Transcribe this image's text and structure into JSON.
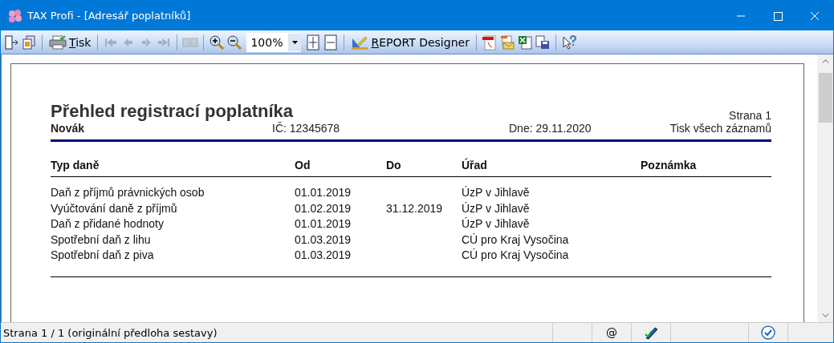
{
  "window": {
    "title": "TAX Profi - [Adresář poplatníků]"
  },
  "toolbar": [
    {
      "kind": "icon",
      "disabled": false
    },
    {
      "kind": "icon",
      "disabled": false
    },
    {
      "kind": "separator"
    },
    {
      "kind": "button",
      "label": "Tisk",
      "disabled": false
    },
    {
      "kind": "separator"
    },
    {
      "kind": "icon",
      "disabled": true
    },
    {
      "kind": "icon",
      "disabled": true
    },
    {
      "kind": "icon",
      "disabled": true
    },
    {
      "kind": "icon",
      "disabled": true
    },
    {
      "kind": "separator"
    },
    {
      "kind": "icon",
      "disabled": true
    },
    {
      "kind": "separator"
    },
    {
      "kind": "icon",
      "disabled": false
    },
    {
      "kind": "icon",
      "disabled": false
    },
    {
      "kind": "combo",
      "value": "100%"
    },
    {
      "kind": "icon",
      "disabled": false
    },
    {
      "kind": "icon",
      "disabled": false
    },
    {
      "kind": "separator"
    },
    {
      "kind": "button",
      "label": "REPORT Designer",
      "disabled": false
    },
    {
      "kind": "separator"
    },
    {
      "kind": "icon",
      "disabled": false
    },
    {
      "kind": "icon",
      "disabled": false
    },
    {
      "kind": "icon",
      "disabled": false
    },
    {
      "kind": "icon",
      "disabled": false
    },
    {
      "kind": "separator"
    },
    {
      "kind": "icon",
      "disabled": false
    }
  ],
  "report": {
    "title": "Přehled registrací poplatníka",
    "page": "Strana 1",
    "name": "Novák",
    "ic": "IČ: 12345678",
    "date": "Dne: 29.11.2020",
    "scope": "Tisk všech záznamů",
    "columns": [
      "Typ daně",
      "Od",
      "Do",
      "Úřad",
      "Poznámka"
    ],
    "rows": [
      [
        "Daň z příjmů právnických osob",
        "01.01.2019",
        "",
        "ÚzP v Jihlavě",
        ""
      ],
      [
        "Vyúčtování daně z příjmů",
        "01.02.2019",
        "31.12.2019",
        "ÚzP v Jihlavě",
        ""
      ],
      [
        "Daň z přidané hodnoty",
        "01.01.2019",
        "",
        "ÚzP v Jihlavě",
        ""
      ],
      [
        "Spotřební daň z lihu",
        "01.03.2019",
        "",
        "CÚ pro Kraj Vysočina",
        ""
      ],
      [
        "Spotřební daň z piva",
        "01.03.2019",
        "",
        "CÚ pro Kraj Vysočina",
        ""
      ]
    ]
  },
  "status_bar": {
    "text": "Strana 1 / 1  (originální předloha sestavy)",
    "at": "@"
  }
}
